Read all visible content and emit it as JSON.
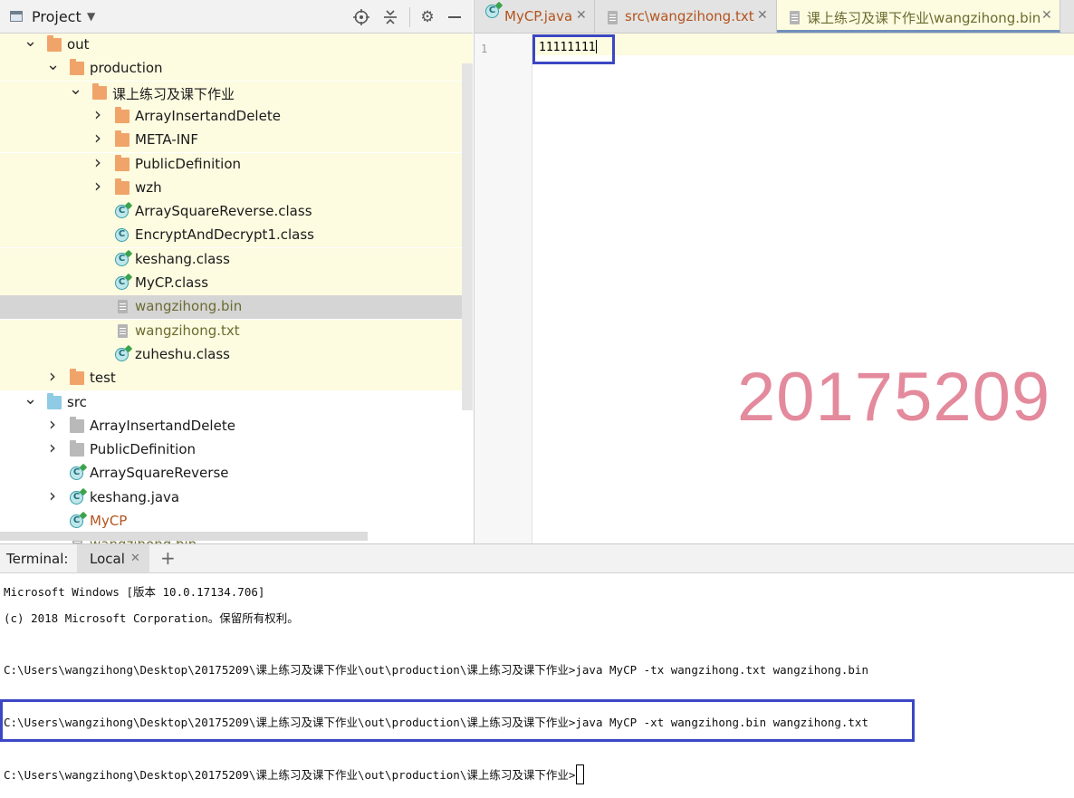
{
  "project": {
    "title": "Project",
    "tree": [
      {
        "label": "out",
        "depth": 0,
        "expanded": true,
        "icon": "folder-icon"
      },
      {
        "label": "production",
        "depth": 1,
        "expanded": true,
        "icon": "folder-icon"
      },
      {
        "label": "课上练习及课下作业",
        "depth": 2,
        "expanded": true,
        "icon": "folder-icon"
      },
      {
        "label": "ArrayInsertandDelete",
        "depth": 3,
        "expanded": false,
        "icon": "folder-icon"
      },
      {
        "label": "META-INF",
        "depth": 3,
        "expanded": false,
        "icon": "folder-icon"
      },
      {
        "label": "PublicDefinition",
        "depth": 3,
        "expanded": false,
        "icon": "folder-icon"
      },
      {
        "label": "wzh",
        "depth": 3,
        "expanded": false,
        "icon": "folder-icon"
      },
      {
        "label": "ArraySquareReverse.class",
        "depth": 3,
        "icon": "class-file-icon"
      },
      {
        "label": "EncryptAndDecrypt1.class",
        "depth": 3,
        "icon": "class-file-icon"
      },
      {
        "label": "keshang.class",
        "depth": 3,
        "icon": "class-file-icon"
      },
      {
        "label": "MyCP.class",
        "depth": 3,
        "icon": "class-file-icon"
      },
      {
        "label": "wangzihong.bin",
        "depth": 3,
        "icon": "text-file-icon",
        "selected": true
      },
      {
        "label": "wangzihong.txt",
        "depth": 3,
        "icon": "text-file-icon"
      },
      {
        "label": "zuheshu.class",
        "depth": 3,
        "icon": "class-file-icon"
      },
      {
        "label": "test",
        "depth": 1,
        "expanded": false,
        "icon": "folder-icon"
      },
      {
        "label": "src",
        "depth": 0,
        "expanded": true,
        "icon": "source-folder-icon"
      },
      {
        "label": "ArrayInsertandDelete",
        "depth": 1,
        "expanded": false,
        "icon": "package-icon"
      },
      {
        "label": "PublicDefinition",
        "depth": 1,
        "expanded": false,
        "icon": "package-icon"
      },
      {
        "label": "ArraySquareReverse",
        "depth": 1,
        "icon": "java-class-icon"
      },
      {
        "label": "keshang.java",
        "depth": 1,
        "expanded": false,
        "icon": "java-class-icon"
      },
      {
        "label": "MyCP",
        "depth": 1,
        "icon": "java-class-icon"
      },
      {
        "label": "wangzihong.bin",
        "depth": 1,
        "icon": "text-file-icon"
      }
    ]
  },
  "editor": {
    "tabs": [
      {
        "label": "MyCP.java",
        "icon": "java-class-icon"
      },
      {
        "label": "src\\wangzihong.txt",
        "icon": "text-file-icon"
      },
      {
        "label": "课上练习及课下作业\\wangzihong.bin",
        "icon": "text-file-icon",
        "active": true
      }
    ],
    "line_number": "1",
    "code": "11111111",
    "watermark": "20175209"
  },
  "terminal": {
    "title": "Terminal:",
    "tab_label": "Local",
    "lines": [
      "Microsoft Windows [版本 10.0.17134.706]",
      "(c) 2018 Microsoft Corporation。保留所有权利。",
      "C:\\Users\\wangzihong\\Desktop\\20175209\\课上练习及课下作业\\out\\production\\课上练习及课下作业>java MyCP -tx wangzihong.txt wangzihong.bin",
      "C:\\Users\\wangzihong\\Desktop\\20175209\\课上练习及课下作业\\out\\production\\课上练习及课下作业>java MyCP -xt wangzihong.bin wangzihong.txt",
      "C:\\Users\\wangzihong\\Desktop\\20175209\\课上练习及课下作业\\out\\production\\课上练习及课下作业>"
    ]
  },
  "colors": {
    "highlight_box": "#3b47c4",
    "watermark": "#e48a9d",
    "yellow_bg": "#fdfbe0",
    "selection": "#d5d5d5"
  }
}
